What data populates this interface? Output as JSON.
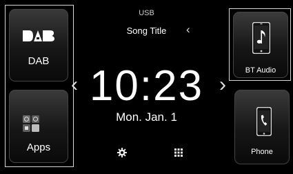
{
  "header": {
    "source_label": "USB",
    "song_title": "Song Title",
    "back_glyph": "‹"
  },
  "left_tiles": {
    "dab": {
      "label": "DAB",
      "icon": "dab-logo-icon"
    },
    "apps": {
      "label": "Apps",
      "icon": "apps-grid-icon"
    }
  },
  "right_tiles": {
    "bt_audio": {
      "label": "BT Audio",
      "icon": "bluetooth-audio-phone-icon"
    },
    "phone": {
      "label": "Phone",
      "icon": "phone-handset-icon"
    }
  },
  "clock": {
    "time": "10:23",
    "date": "Mon. Jan. 1",
    "prev_glyph": "‹",
    "next_glyph": "›"
  },
  "bottom_bar": {
    "settings_icon": "gear-icon",
    "menu_icon": "grid-menu-icon"
  },
  "colors": {
    "background": "#000000",
    "highlight_border": "#d8d8d8",
    "tile_gradient_top": "#3a3a3a",
    "tile_gradient_bottom": "#0a0a0a"
  }
}
